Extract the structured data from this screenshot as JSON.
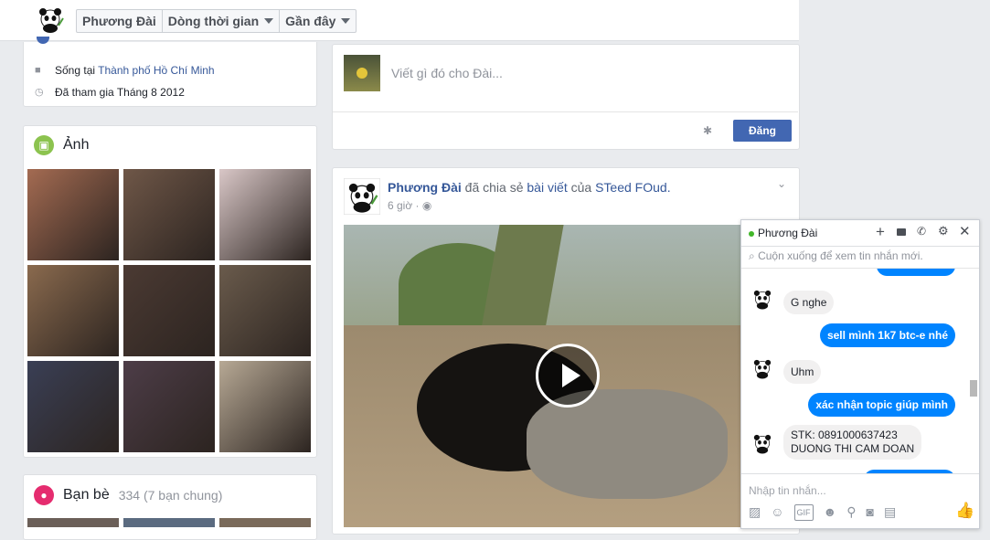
{
  "header": {
    "breadcrumb": [
      "Phương Đài",
      "Dòng thời gian",
      "Gần đây"
    ]
  },
  "about": {
    "lives_prefix": "Sống tại",
    "lives_city": "Thành phố Hồ Chí Minh",
    "joined": "Đã tham gia Tháng 8 2012"
  },
  "photos": {
    "title": "Ảnh",
    "colors": [
      "#a46b52",
      "#6f5748",
      "#d9c7c7",
      "#8a6a4e",
      "#4b3a33",
      "#6a5b4c",
      "#3a3f55",
      "#4d3d48",
      "#b7a995"
    ]
  },
  "friends": {
    "title": "Bạn bè",
    "count": "334 (7 bạn chung)"
  },
  "composer": {
    "placeholder": "Viết gì đó cho Đài...",
    "post_label": "Đăng"
  },
  "post": {
    "author": "Phương Đài",
    "action": "đã chia sẻ",
    "object": "bài viết",
    "of": "của",
    "page": "STeed FOud.",
    "time": "6 giờ"
  },
  "chat": {
    "name": "Phương Đài",
    "notice": "Cuộn xuống để xem tin nhắn mới.",
    "messages": [
      {
        "from": "them",
        "text": "G nghe"
      },
      {
        "from": "me",
        "text": "sell mình 1k7 btc-e nhé"
      },
      {
        "from": "them",
        "text": "Uhm"
      },
      {
        "from": "me",
        "text": "xác nhận topic giúp mình"
      },
      {
        "from": "them",
        "line1": "STK: 0891000637423",
        "line2": "DUONG THI CAM DOAN"
      }
    ],
    "input_placeholder": "Nhập tin nhắn..."
  },
  "colors": {
    "accent": "#4267b2",
    "link": "#365899",
    "messenger_blue": "#0084ff"
  }
}
